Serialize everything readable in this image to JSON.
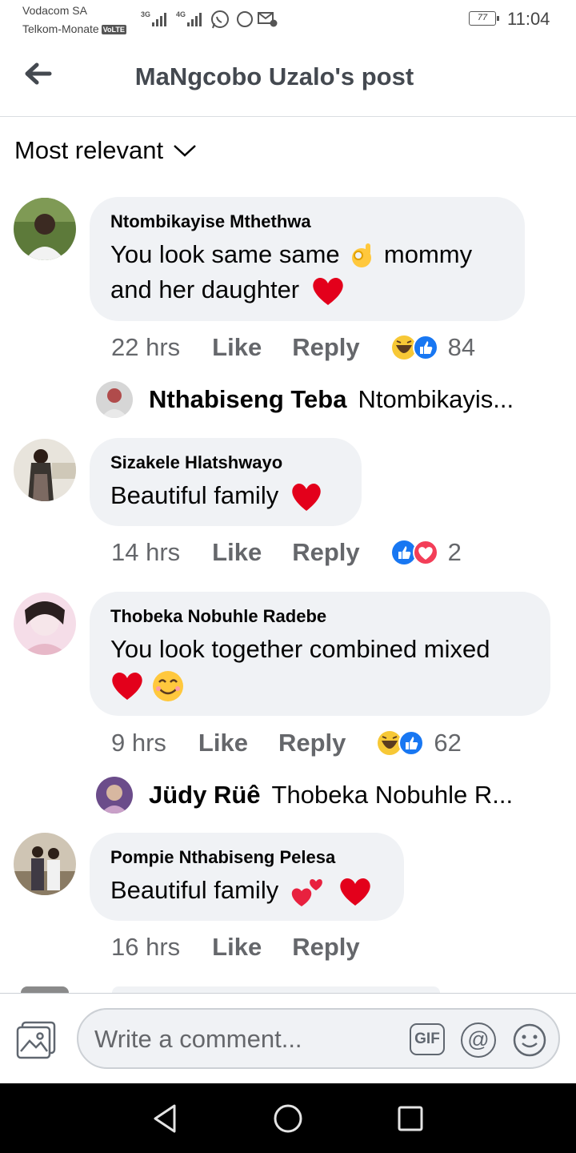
{
  "status_bar": {
    "carrier1": "Vodacom SA",
    "carrier2": "Telkom-Monate",
    "volte": "VoLTE",
    "net1": "3G",
    "net2": "4G",
    "battery": "77",
    "time": "11:04"
  },
  "header": {
    "title": "MaNgcobo Uzalo's post"
  },
  "sort": {
    "label": "Most relevant"
  },
  "comments": [
    {
      "author": "Ntombikayise Mthethwa",
      "line1": "You look same same",
      "line1b": "mommy",
      "line2": "and her daughter",
      "time": "22 hrs",
      "like": "Like",
      "reply": "Reply",
      "reaction_count": "84",
      "reply_preview": {
        "name": "Nthabiseng Teba",
        "text": "Ntombikayis..."
      }
    },
    {
      "author": "Sizakele Hlatshwayo",
      "line1": "Beautiful family",
      "time": "14 hrs",
      "like": "Like",
      "reply": "Reply",
      "reaction_count": "2"
    },
    {
      "author": "Thobeka Nobuhle Radebe",
      "line1": "You look together combined mixed",
      "time": "9 hrs",
      "like": "Like",
      "reply": "Reply",
      "reaction_count": "62",
      "reply_preview": {
        "name": "Jüdy Rüê",
        "text": "Thobeka Nobuhle R..."
      }
    },
    {
      "author": "Pompie Nthabiseng Pelesa",
      "line1": "Beautiful family",
      "time": "16 hrs",
      "like": "Like",
      "reply": "Reply"
    }
  ],
  "composer": {
    "placeholder": "Write a comment...",
    "gif": "GIF",
    "at": "@"
  },
  "colors": {
    "bubble": "#f0f2f5",
    "like_blue": "#1877f2",
    "love_red": "#f33e58",
    "heart": "#e3001b",
    "meta_gray": "#65676b"
  }
}
